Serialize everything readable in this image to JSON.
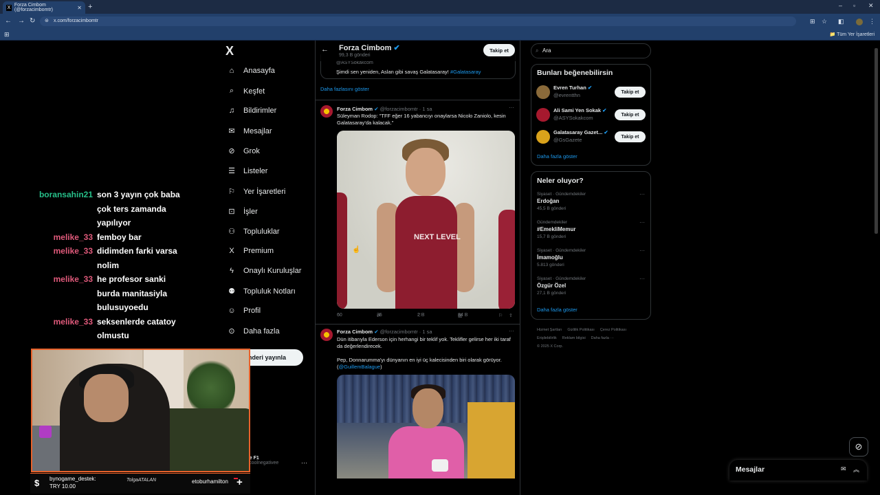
{
  "browser": {
    "tab_title": "Forza Cimbom (@forzacimbomtr)",
    "tab_favicon": "X",
    "new_tab": "+",
    "url": "x.com/forzacimbomtr",
    "bookmarks_all": "Tüm Yer İşaretleri"
  },
  "nav": {
    "logo": "X",
    "items": [
      {
        "icon": "home-icon",
        "glyph": "⌂",
        "label": "Anasayfa"
      },
      {
        "icon": "search-icon",
        "glyph": "⌕",
        "label": "Keşfet"
      },
      {
        "icon": "bell-icon",
        "glyph": "♫",
        "label": "Bildirimler"
      },
      {
        "icon": "mail-icon",
        "glyph": "✉",
        "label": "Mesajlar"
      },
      {
        "icon": "grok-icon",
        "glyph": "⊘",
        "label": "Grok"
      },
      {
        "icon": "list-icon",
        "glyph": "☰",
        "label": "Listeler"
      },
      {
        "icon": "bookmark-icon",
        "glyph": "⚐",
        "label": "Yer İşaretleri"
      },
      {
        "icon": "briefcase-icon",
        "glyph": "⊡",
        "label": "İşler"
      },
      {
        "icon": "communities-icon",
        "glyph": "⚇",
        "label": "Topluluklar"
      },
      {
        "icon": "premium-icon",
        "glyph": "X",
        "label": "Premium"
      },
      {
        "icon": "bolt-icon",
        "glyph": "ϟ",
        "label": "Onaylı Kuruluşlar"
      },
      {
        "icon": "notes-icon",
        "glyph": "⚉",
        "label": "Topluluk Notları"
      },
      {
        "icon": "profile-icon",
        "glyph": "☺",
        "label": "Profil"
      },
      {
        "icon": "more-icon",
        "glyph": "⊙",
        "label": "Daha fazla"
      }
    ],
    "post_button": "gönderi yayınla",
    "account_name": "Jee F1",
    "account_handle": "@coolnegativee",
    "account_more": "···"
  },
  "chat": [
    {
      "user": "boransahin21",
      "msg": "son 3 yayın çok baba",
      "color": "green"
    },
    {
      "user": "",
      "msg": "çok ters zamanda",
      "color": ""
    },
    {
      "user": "",
      "msg": "yapılıyor",
      "color": ""
    },
    {
      "user": "melike_33",
      "msg": "femboy bar",
      "color": "pink"
    },
    {
      "user": "melike_33",
      "msg": "didimden farki varsa",
      "color": "pink"
    },
    {
      "user": "",
      "msg": "nolim",
      "color": ""
    },
    {
      "user": "melike_33",
      "msg": "he profesor sanki",
      "color": "pink"
    },
    {
      "user": "",
      "msg": "burda manitasiyla",
      "color": ""
    },
    {
      "user": "",
      "msg": "bulusuyoedu",
      "color": ""
    },
    {
      "user": "melike_33",
      "msg": "seksenlerde catatoy",
      "color": "pink"
    },
    {
      "user": "",
      "msg": "olmustu",
      "color": ""
    }
  ],
  "donation": {
    "icon": "$",
    "name": "bynogame_destek:",
    "amount": "TRY 10.00",
    "signature": "TolgaATALAN",
    "right_name": "etoburhamilton"
  },
  "main": {
    "header_title": "Forza Cimbom",
    "header_sub": "99,3 B gönderi",
    "follow": "Takip et",
    "quote_handle": "@ASYSokakcom",
    "quote_text": "Şimdi sen yeniden, Aslan gibi savaş Galatasaray!",
    "quote_tag": "#Galatasaray",
    "show_more": "Daha fazlasını göster",
    "posts": [
      {
        "name": "Forza Cimbom",
        "handle": "@forzacimbomtr",
        "time": "· 1 sa",
        "text": "Süleyman Rodop: \"TFF eğer 16 yabancıyı onaylarsa Nicolo Zaniolo, kesin Galatasaray'da kalacak.\"",
        "photo_logo": "NEXT LEVEL",
        "replies": "60",
        "reposts": "35",
        "likes": "2 B",
        "views": "84 B"
      },
      {
        "name": "Forza Cimbom",
        "handle": "@forzacimbomtr",
        "time": "· 1 sa",
        "text1": "Dün itibarıyla Ederson için herhangi bir teklif yok. Teklifler gelirse her iki taraf da değerlendirecek.",
        "text2": "Pep, Donnarumma'yı dünyanın en iyi üç kalecisinden biri olarak görüyor. (",
        "mention": "@GuillemBalague",
        "text3": ")"
      }
    ]
  },
  "right": {
    "search_placeholder": "Ara",
    "suggest_title": "Bunları beğenebilirsin",
    "suggestions": [
      {
        "name": "Evren Turhan",
        "handle": "@evrentthn",
        "follow": "Takip et"
      },
      {
        "name": "Ali Sami Yen Sokak",
        "handle": "@ASYSokakcom",
        "follow": "Takip et"
      },
      {
        "name": "Galatasaray Gazet...",
        "handle": "@GsGazete",
        "follow": "Takip et"
      }
    ],
    "suggest_more": "Daha fazla göster",
    "trends_title": "Neler oluyor?",
    "trends": [
      {
        "cat": "Siyaset · Gündemdekiler",
        "name": "Erdoğan",
        "count": "45,5 B gönderi"
      },
      {
        "cat": "Gündemdekiler",
        "name": "#EmekliMemur",
        "count": "15,7 B gönderi"
      },
      {
        "cat": "Siyaset · Gündemdekiler",
        "name": "İmamoğlu",
        "count": "5.813 gönderi"
      },
      {
        "cat": "Siyaset · Gündemdekiler",
        "name": "Özgür Özel",
        "count": "27,1 B gönderi"
      }
    ],
    "trends_more": "Daha fazla göster",
    "footer": [
      "Hizmet Şartları",
      "Gizlilik Politikası",
      "Çerez Politikası",
      "Erişilebilirlik",
      "Reklam bilgisi",
      "Daha fazla ···",
      "© 2025 X Corp."
    ]
  },
  "dock": {
    "title": "Mesajlar"
  }
}
